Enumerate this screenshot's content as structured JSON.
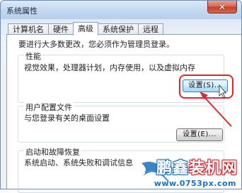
{
  "window": {
    "title": "系统属性",
    "close_label": "✕"
  },
  "tabs": [
    {
      "label": "计算机名",
      "active": false
    },
    {
      "label": "硬件",
      "active": false
    },
    {
      "label": "高级",
      "active": true
    },
    {
      "label": "系统保护",
      "active": false
    },
    {
      "label": "远程",
      "active": false
    }
  ],
  "advanced": {
    "admin_note": "要进行大多数更改，您必须作为管理员登录。",
    "performance": {
      "title": "性能",
      "description": "视觉效果，处理器计划，内存使用，以及虚拟内存",
      "button": "设置(S)..."
    },
    "user_profiles": {
      "title": "用户配置文件",
      "description": "与您登录有关的桌面设置",
      "button": "设置(E)..."
    },
    "startup_recovery": {
      "title": "启动和故障恢复",
      "description": "系统启动、系统失败和调试信息"
    }
  },
  "annotation": {
    "highlight_color": "#e0262d"
  },
  "watermark": {
    "brand_part1": "鹏鑫",
    "brand_part2": "装机网",
    "url": "www.0753px.com",
    "blue": "#1c6fb8",
    "red": "#d1242a"
  }
}
